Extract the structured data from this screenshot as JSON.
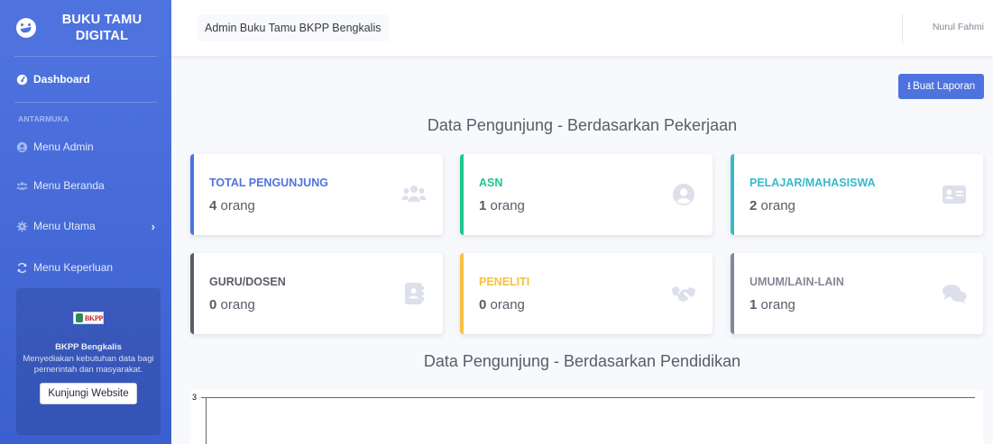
{
  "sidebar": {
    "brand_line1": "BUKU TAMU",
    "brand_line2": "DIGITAL",
    "dashboard_label": "Dashboard",
    "heading": "ANTARMUKA",
    "items": [
      {
        "label": "Menu Admin",
        "icon": "user-circle-icon"
      },
      {
        "label": "Menu Beranda",
        "icon": "users-icon"
      },
      {
        "label": "Menu Utama",
        "icon": "gear-icon"
      },
      {
        "label": "Menu Keperluan",
        "icon": "refresh-icon"
      }
    ],
    "card": {
      "logo_text": "BKPP",
      "title": "BKPP Bengkalis",
      "description": "Menyediakan kebutuhan data bagi pemerintah dan masyarakat.",
      "button": "Kunjungi Website"
    }
  },
  "topbar": {
    "title": "Admin Buku Tamu BKPP Bengkalis",
    "user": "Nurul Fahmi"
  },
  "main": {
    "report_button": "Buat Laporan",
    "section1_title": "Data Pengunjung - Berdasarkan Pekerjaan",
    "section2_title": "Data Pengunjung - Berdasarkan Pendidikan",
    "unit": "orang",
    "cards": [
      {
        "label": "TOTAL PENGUNJUNG",
        "value": "4",
        "icon": "users-icon",
        "color": "#4e73df"
      },
      {
        "label": "ASN",
        "value": "1",
        "icon": "user-circle-icon",
        "color": "#1cc88a"
      },
      {
        "label": "PELAJAR/MAHASISWA",
        "value": "2",
        "icon": "id-card-icon",
        "color": "#36b9cc"
      },
      {
        "label": "GURU/DOSEN",
        "value": "0",
        "icon": "address-book-icon",
        "color": "#5a5c69"
      },
      {
        "label": "PENELITI",
        "value": "0",
        "icon": "handshake-icon",
        "color": "#f6c23e"
      },
      {
        "label": "UMUM/LAIN-LAIN",
        "value": "1",
        "icon": "comments-icon",
        "color": "#858796"
      }
    ],
    "chart_top_tick": "3"
  },
  "colors": {
    "primary": "#4e73df",
    "success": "#1cc88a",
    "info": "#36b9cc",
    "warning": "#f6c23e",
    "secondary": "#858796",
    "dark": "#5a5c69"
  }
}
